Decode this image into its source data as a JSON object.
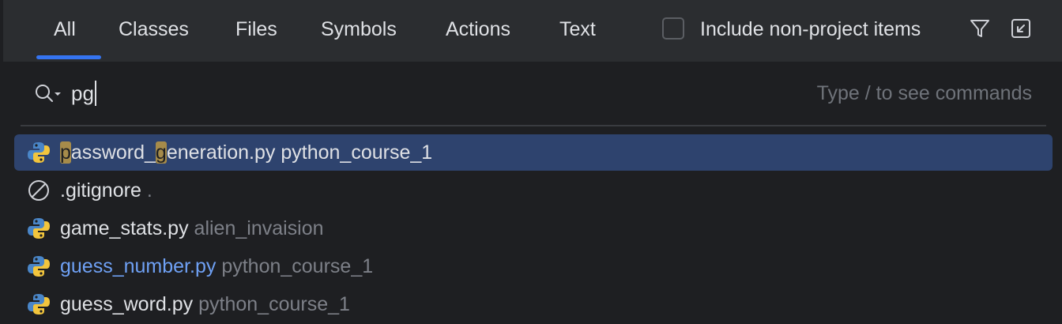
{
  "tabs": [
    {
      "label": "All",
      "active": true
    },
    {
      "label": "Classes"
    },
    {
      "label": "Files"
    },
    {
      "label": "Symbols"
    },
    {
      "label": "Actions"
    },
    {
      "label": "Text"
    }
  ],
  "include_non_project": {
    "label": "Include non-project items",
    "checked": false
  },
  "header_icons": [
    "filter-icon",
    "collapse-popup-icon"
  ],
  "search": {
    "value": "pg",
    "placeholder": "Type / to see commands",
    "icon": "search-icon"
  },
  "results": [
    {
      "icon": "python-icon",
      "name_parts": [
        "p",
        "assword_",
        "g",
        "eneration.py"
      ],
      "highlighted": [
        true,
        false,
        true,
        false
      ],
      "location": "python_course_1",
      "selected": true
    },
    {
      "icon": "ignored-file-icon",
      "name": ".gitignore",
      "location": "."
    },
    {
      "icon": "python-icon",
      "name": "game_stats.py",
      "location": "alien_invaision"
    },
    {
      "icon": "python-icon",
      "name": "guess_number.py",
      "location": "python_course_1",
      "modified": true
    },
    {
      "icon": "python-icon",
      "name": "guess_word.py",
      "location": "python_course_1"
    }
  ],
  "colors": {
    "accent": "#3574f0",
    "selection": "#2e436e",
    "match_highlight": "#a68b4a",
    "modified_file": "#6fa1f5"
  }
}
